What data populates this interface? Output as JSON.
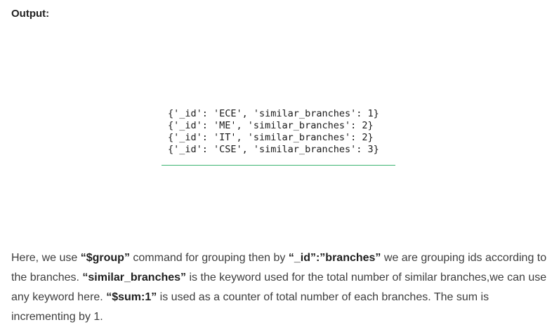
{
  "heading": "Output:",
  "code_lines": [
    "{'_id': 'ECE', 'similar_branches': 1}",
    "{'_id': 'ME', 'similar_branches': 2}",
    "{'_id': 'IT', 'similar_branches': 2}",
    "{'_id': 'CSE', 'similar_branches': 3}"
  ],
  "colors": {
    "code_underline": "#3cb371"
  },
  "paragraph": {
    "t1": "Here, we use ",
    "b1": "“$group”",
    "t2": " command for grouping then by ",
    "b2": "“_id”:”branches”",
    "t3": " we are grouping ids according to the branches. ",
    "b3": "“similar_branches”",
    "t4": " is the keyword used for the total number of similar branches,we can use any keyword here. ",
    "b4": "“$sum:1”",
    "t5": " is used as a counter of total number of each branches. The sum is incrementing by 1."
  }
}
